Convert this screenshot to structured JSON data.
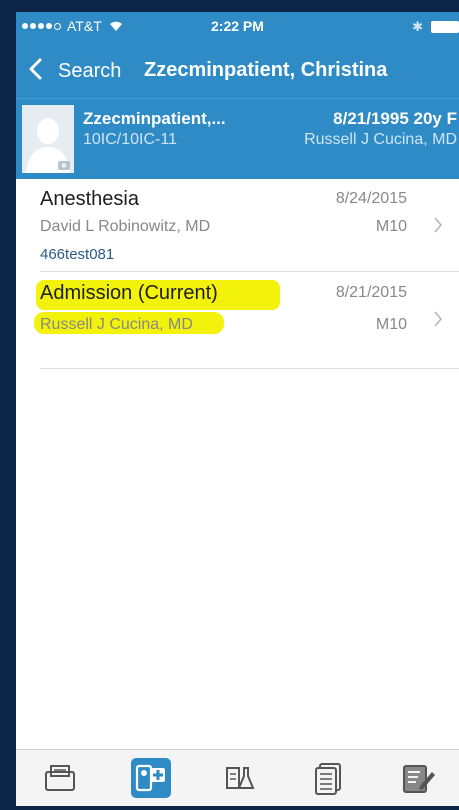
{
  "status_bar": {
    "carrier": "AT&T",
    "time": "2:22 PM"
  },
  "nav": {
    "back_label": "Search",
    "title": "Zzecminpatient, Christina"
  },
  "patient": {
    "name": "Zzecminpatient,...",
    "location": "10IC/10IC-11",
    "dob_age_sex": "8/21/1995 20y F",
    "provider": "Russell J Cucina, MD"
  },
  "encounters": [
    {
      "type": "Anesthesia",
      "date": "8/24/2015",
      "provider": "David L Robinowitz, MD",
      "department": "M10",
      "account": "466test081"
    },
    {
      "type": "Admission (Current)",
      "date": "8/21/2015",
      "provider": "Russell J Cucina, MD",
      "department": "M10",
      "highlight_color": "#f2f20a"
    }
  ],
  "tab_bar": {
    "icons": [
      "folder-icon",
      "patient-chart-icon",
      "lab-flask-icon",
      "documents-icon",
      "notes-edit-icon"
    ],
    "selected": "patient-chart-icon",
    "accent": "#2f8bc6"
  }
}
